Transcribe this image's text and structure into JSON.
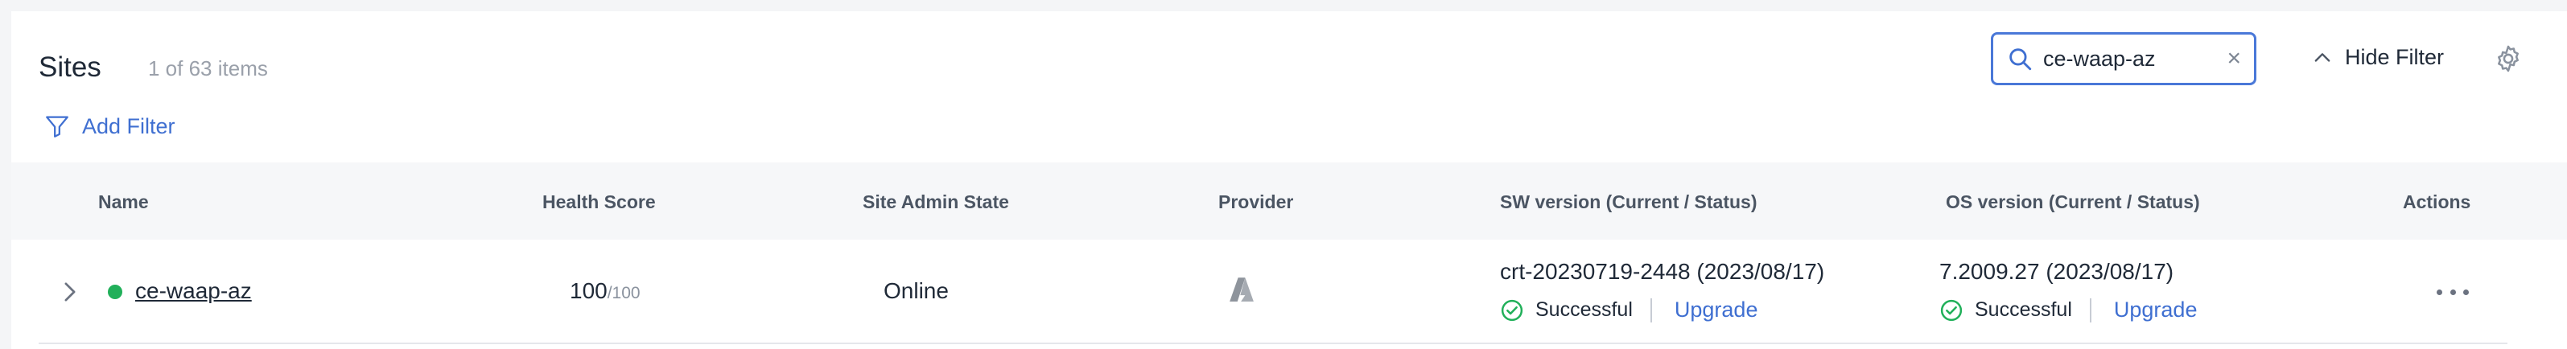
{
  "header": {
    "title": "Sites",
    "count": "1 of 63 items",
    "add_filter_label": "Add Filter",
    "hide_filter_label": "Hide Filter",
    "search_value": "ce-waap-az",
    "clear_glyph": "×"
  },
  "icons": {
    "filter": "filter-funnel-icon",
    "search": "search-icon",
    "clear": "close-icon",
    "hide_filter": "chevron-up-icon",
    "settings": "gear-icon",
    "expand": "chevron-right-icon",
    "provider": "azure-provider-icon",
    "status": "check-circle-icon",
    "actions": "more-horizontal-icon"
  },
  "colors": {
    "accent": "#3f6fd1",
    "success": "#21b05a",
    "header_bg": "#f6f7f9"
  },
  "columns": [
    "Name",
    "Health Score",
    "Site Admin State",
    "Provider",
    "SW version (Current / Status)",
    "OS version (Current / Status)",
    "Actions"
  ],
  "rows": [
    {
      "name": "ce-waap-az",
      "health_score": "100",
      "health_max": "/100",
      "admin_state": "Online",
      "provider": "Azure",
      "sw_version": "crt-20230719-2448 (2023/08/17)",
      "sw_status": "Successful",
      "sw_action": "Upgrade",
      "os_version": "7.2009.27 (2023/08/17)",
      "os_status": "Successful",
      "os_action": "Upgrade"
    }
  ]
}
